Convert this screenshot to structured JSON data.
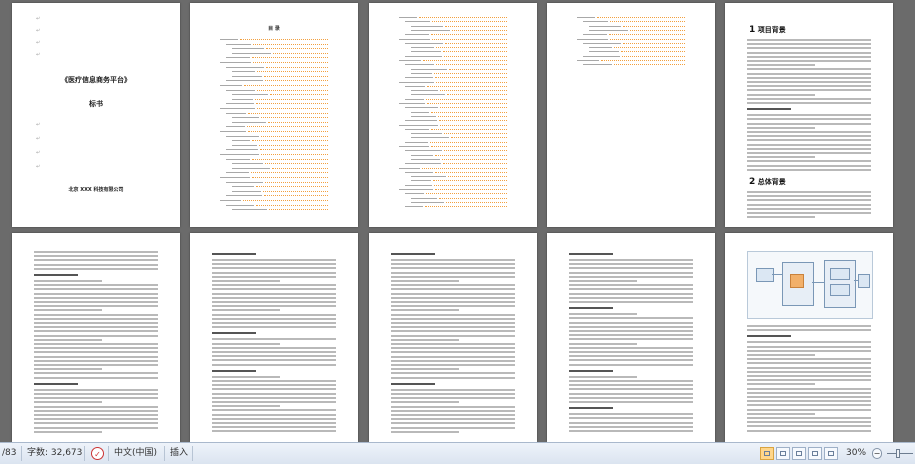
{
  "status": {
    "page_count": "/83",
    "word_count_label": "字数: 32,673",
    "language": "中文(中国)",
    "insert_mode": "插入",
    "zoom": "30%",
    "zoom_minus": "−",
    "zoom_plus": "+"
  },
  "cover": {
    "title": "《医疗信息商务平台》",
    "subtitle": "标书",
    "company": "北京 XXX 科技有限公司"
  },
  "toc": {
    "title": "目  录"
  },
  "chapters": {
    "project_background_num": "1",
    "project_background": "项目背景",
    "construction_bg_num": "2",
    "construction_bg": "总体背景"
  },
  "colors": {
    "page_bg": "#6b6b6b",
    "toc_leader": "#f2a040",
    "statusbar": "#dbe4f0",
    "active_view": "#ffd68a"
  }
}
